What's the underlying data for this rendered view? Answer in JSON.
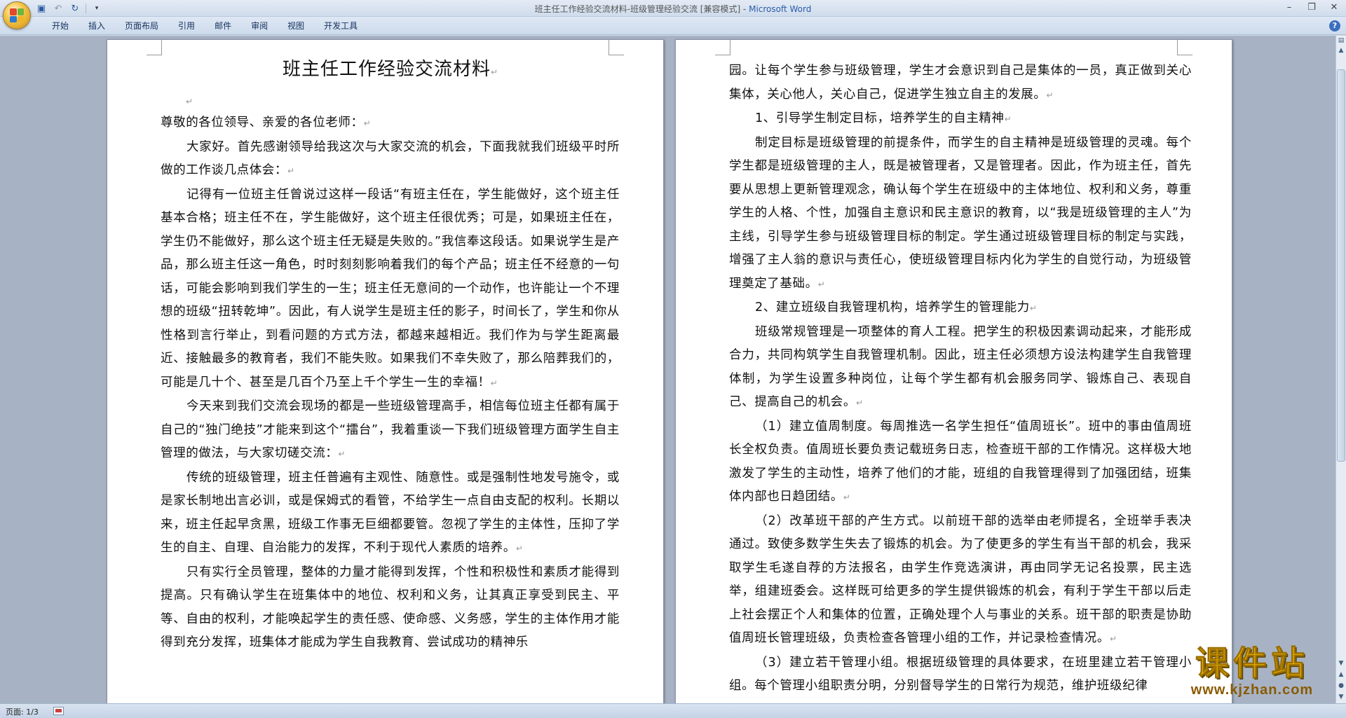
{
  "window": {
    "doc_title": "班主任工作经验交流材料-班级管理经验交流 [兼容模式] - ",
    "app_name": "Microsoft Word"
  },
  "ribbon": {
    "tabs": [
      "开始",
      "插入",
      "页面布局",
      "引用",
      "邮件",
      "审阅",
      "视图",
      "开发工具"
    ]
  },
  "document": {
    "title": "班主任工作经验交流材料",
    "left_paragraphs": [
      {
        "text": "尊敬的各位领导、亲爱的各位老师：",
        "indent": false
      },
      {
        "text": "大家好。首先感谢领导给我这次与大家交流的机会，下面我就我们班级平时所做的工作谈几点体会：",
        "indent": true
      },
      {
        "text": "记得有一位班主任曾说过这样一段话“有班主任在，学生能做好，这个班主任基本合格；班主任不在，学生能做好，这个班主任很优秀；可是，如果班主任在，学生仍不能做好，那么这个班主任无疑是失败的。”我信奉这段话。如果说学生是产品，那么班主任这一角色，时时刻刻影响着我们的每个产品；班主任不经意的一句话，可能会影响到我们学生的一生；班主任无意间的一个动作，也许能让一个不理想的班级“扭转乾坤”。因此，有人说学生是班主任的影子，时间长了，学生和你从性格到言行举止，到看问题的方式方法，都越来越相近。我们作为与学生距离最近、接触最多的教育者，我们不能失败。如果我们不幸失败了，那么陪葬我们的，可能是几十个、甚至是几百个乃至上千个学生一生的幸福！",
        "indent": true
      },
      {
        "text": "今天来到我们交流会现场的都是一些班级管理高手，相信每位班主任都有属于自己的“独门绝技”才能来到这个“擂台”，我着重谈一下我们班级管理方面学生自主管理的做法，与大家切磋交流：",
        "indent": true
      },
      {
        "text": "传统的班级管理，班主任普遍有主观性、随意性。或是强制性地发号施令，或是家长制地出言必训，或是保姆式的看管，不给学生一点自由支配的权利。长期以来，班主任起早贪黑，班级工作事无巨细都要管。忽视了学生的主体性，压抑了学生的自主、自理、自治能力的发挥，不利于现代人素质的培养。",
        "indent": true
      },
      {
        "text": "只有实行全员管理，整体的力量才能得到发挥，个性和积极性和素质才能得到提高。只有确认学生在班集体中的地位、权利和义务，让其真正享受到民主、平等、自由的权利，才能唤起学生的责任感、使命感、义务感，学生的主体作用才能得到充分发挥，班集体才能成为学生自我教育、尝试成功的精神乐",
        "indent": true,
        "no_mark": true
      }
    ],
    "right_paragraphs": [
      {
        "text": "园。让每个学生参与班级管理，学生才会意识到自己是集体的一员，真正做到关心集体，关心他人，关心自己，促进学生独立自主的发展。",
        "indent": false
      },
      {
        "text": "1、引导学生制定目标，培养学生的自主精神",
        "indent": true
      },
      {
        "text": "制定目标是班级管理的前提条件，而学生的自主精神是班级管理的灵魂。每个学生都是班级管理的主人，既是被管理者，又是管理者。因此，作为班主任，首先要从思想上更新管理观念，确认每个学生在班级中的主体地位、权利和义务，尊重学生的人格、个性，加强自主意识和民主意识的教育，以“我是班级管理的主人”为主线，引导学生参与班级管理目标的制定。学生通过班级管理目标的制定与实践，增强了主人翁的意识与责任心，使班级管理目标内化为学生的自觉行动，为班级管理奠定了基础。",
        "indent": true
      },
      {
        "text": "2、建立班级自我管理机构，培养学生的管理能力",
        "indent": true
      },
      {
        "text": "班级常规管理是一项整体的育人工程。把学生的积极因素调动起来，才能形成合力，共同构筑学生自我管理机制。因此，班主任必须想方设法构建学生自我管理体制，为学生设置多种岗位，让每个学生都有机会服务同学、锻炼自己、表现自己、提高自己的机会。",
        "indent": true
      },
      {
        "text": "（1）建立值周制度。每周推选一名学生担任“值周班长”。班中的事由值周班长全权负责。值周班长要负责记载班务日志，检查班干部的工作情况。这样极大地激发了学生的主动性，培养了他们的才能，班组的自我管理得到了加强团结，班集体内部也日趋团结。",
        "indent": true
      },
      {
        "text": "（2）改革班干部的产生方式。以前班干部的选举由老师提名，全班举手表决通过。致使多数学生失去了锻炼的机会。为了使更多的学生有当干部的机会，我采取学生毛遂自荐的方法报名，由学生作竞选演讲，再由同学无记名投票，民主选举，组建班委会。这样既可给更多的学生提供锻炼的机会，有利于学生干部以后走上社会摆正个人和集体的位置，正确处理个人与事业的关系。班干部的职责是协助值周班长管理班级，负责检查各管理小组的工作，并记录检查情况。",
        "indent": true
      },
      {
        "text": "（3）建立若干管理小组。根据班级管理的具体要求，在班里建立若干管理小组。每个管理小组职责分明，分别督导学生的日常行为规范，维护班级纪律",
        "indent": true,
        "no_mark": true
      }
    ]
  },
  "status": {
    "page_indicator": "页面: 1/3"
  },
  "watermark": {
    "cn": "课件站",
    "url": "www.kjzhan.com"
  }
}
